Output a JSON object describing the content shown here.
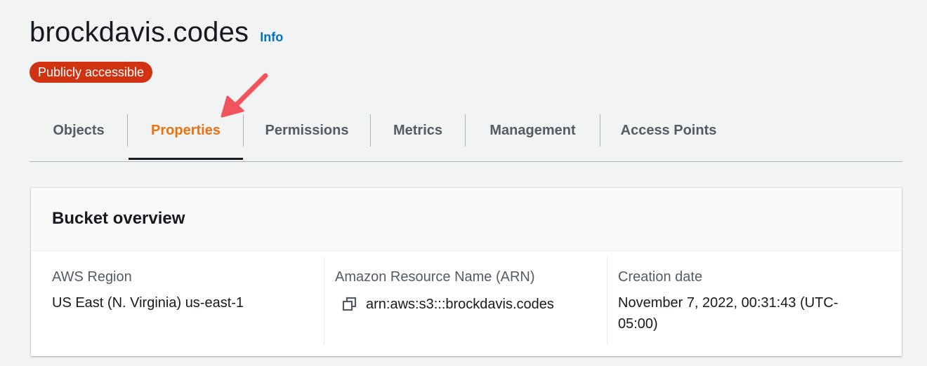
{
  "header": {
    "title": "brockdavis.codes",
    "info_label": "Info"
  },
  "badge": {
    "label": "Publicly accessible",
    "color": "#d13212"
  },
  "tabs": [
    {
      "label": "Objects",
      "active": false
    },
    {
      "label": "Properties",
      "active": true
    },
    {
      "label": "Permissions",
      "active": false
    },
    {
      "label": "Metrics",
      "active": false
    },
    {
      "label": "Management",
      "active": false
    },
    {
      "label": "Access Points",
      "active": false
    }
  ],
  "overview": {
    "title": "Bucket overview",
    "region_label": "AWS Region",
    "region_value": "US East (N. Virginia) us-east-1",
    "arn_label": "Amazon Resource Name (ARN)",
    "arn_value": "arn:aws:s3:::brockdavis.codes",
    "arn_icon": "copy-icon",
    "creation_label": "Creation date",
    "creation_value": "November 7, 2022, 00:31:43 (UTC-05:00)"
  },
  "annotation": {
    "arrow_icon": "arrow-annotation-icon",
    "arrow_color": "#f2545b"
  },
  "colors": {
    "accent": "#ec7211",
    "link": "#0073bb"
  }
}
